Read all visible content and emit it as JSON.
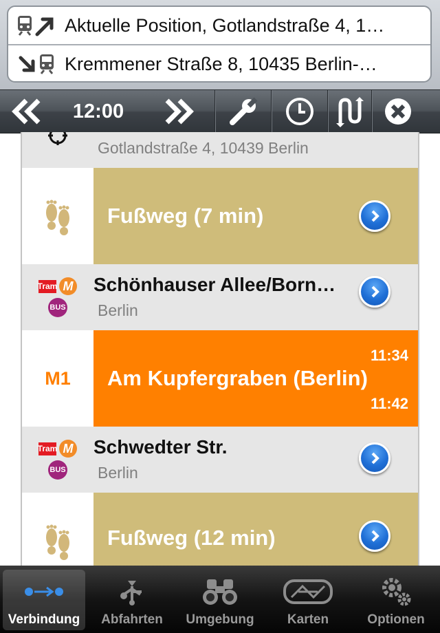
{
  "header": {
    "from": "Aktuelle Position, Gotlandstraße 4, 1…",
    "to": "Kremmener Straße 8, 10435 Berlin-…"
  },
  "toolbar": {
    "time": "12:00",
    "icons": [
      "earlier-icon",
      "later-icon",
      "wrench-icon",
      "clock-icon",
      "swap-icon",
      "close-icon"
    ]
  },
  "list": {
    "start_address": "Gotlandstraße 4, 10439 Berlin",
    "walk1": "Fußweg (7 min)",
    "stop1": {
      "name": "Schönhauser Allee/Born…",
      "city": "Berlin"
    },
    "ride": {
      "line": "M1",
      "destination": "Am Kupfergraben (Berlin)",
      "dep": "11:34",
      "arr": "11:42"
    },
    "stop2": {
      "name": "Schwedter Str.",
      "city": "Berlin"
    },
    "walk2": "Fußweg (12 min)",
    "badges": {
      "tram": "Tram",
      "metro": "M",
      "bus": "BUS"
    }
  },
  "tabs": [
    {
      "label": "Verbindung",
      "icon": "connection-icon",
      "active": true
    },
    {
      "label": "Abfahrten",
      "icon": "departures-icon"
    },
    {
      "label": "Umgebung",
      "icon": "binoculars-icon"
    },
    {
      "label": "Karten",
      "icon": "map-icon"
    },
    {
      "label": "Optionen",
      "icon": "gears-icon"
    }
  ],
  "colors": {
    "walk": "#cfbc7a",
    "line_m1": "#ff8000",
    "stop_bg": "#e6e6e6"
  }
}
